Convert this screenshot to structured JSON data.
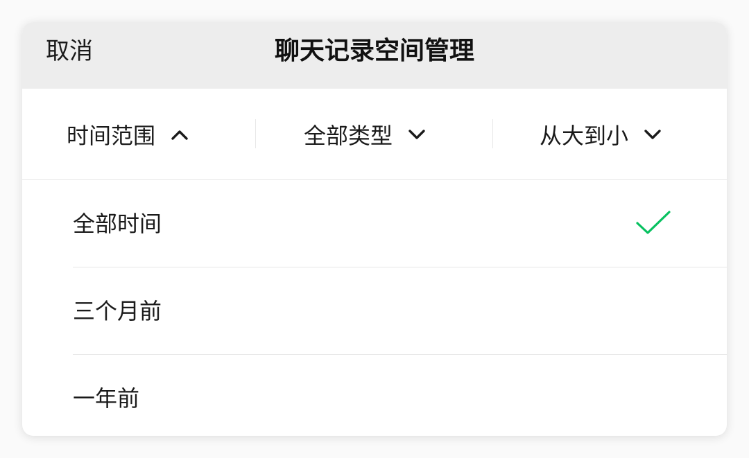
{
  "nav": {
    "cancel_label": "取消",
    "title": "聊天记录空间管理",
    "background": "#ededed"
  },
  "filters": [
    {
      "label": "时间范围",
      "state": "expanded",
      "icon": "chevron-up-icon"
    },
    {
      "label": "全部类型",
      "state": "collapsed",
      "icon": "chevron-down-icon"
    },
    {
      "label": "从大到小",
      "state": "collapsed",
      "icon": "chevron-down-icon"
    }
  ],
  "time_options": [
    {
      "label": "全部时间",
      "selected": true
    },
    {
      "label": "三个月前",
      "selected": false
    },
    {
      "label": "一年前",
      "selected": false
    }
  ],
  "colors": {
    "accent": "#07c160",
    "text": "#1a1a1a"
  },
  "icons": {
    "selected": "checkmark-icon"
  }
}
